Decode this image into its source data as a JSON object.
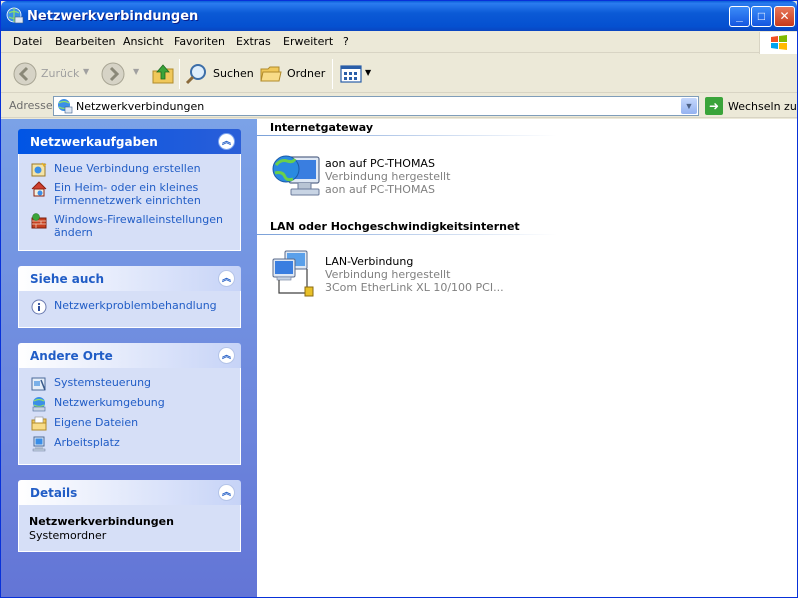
{
  "window": {
    "title": "Netzwerkverbindungen"
  },
  "menu": [
    "Datei",
    "Bearbeiten",
    "Ansicht",
    "Favoriten",
    "Extras",
    "Erweitert",
    "?"
  ],
  "toolbar": {
    "back": "Zurück",
    "search": "Suchen",
    "folders": "Ordner"
  },
  "address": {
    "label": "Adresse",
    "value": "Netzwerkverbindungen",
    "go": "Wechseln zu"
  },
  "taskpane": {
    "network_tasks": {
      "title": "Netzwerkaufgaben",
      "items": [
        "Neue Verbindung erstellen",
        "Ein Heim- oder ein kleines Firmennetzwerk einrichten",
        "Windows-Firewalleinstellungen ändern"
      ]
    },
    "see_also": {
      "title": "Siehe auch",
      "items": [
        "Netzwerkproblembehandlung"
      ]
    },
    "other_places": {
      "title": "Andere Orte",
      "items": [
        "Systemsteuerung",
        "Netzwerkumgebung",
        "Eigene Dateien",
        "Arbeitsplatz"
      ]
    },
    "details": {
      "title": "Details",
      "name": "Netzwerkverbindungen",
      "type": "Systemordner"
    }
  },
  "groups": [
    {
      "title": "Internetgateway",
      "items": [
        {
          "name": "aon auf PC-THOMAS",
          "status": "Verbindung hergestellt",
          "device": "aon auf PC-THOMAS"
        }
      ]
    },
    {
      "title": "LAN oder Hochgeschwindigkeitsinternet",
      "items": [
        {
          "name": "LAN-Verbindung",
          "status": "Verbindung hergestellt",
          "device": "3Com EtherLink XL 10/100 PCI..."
        }
      ]
    }
  ]
}
